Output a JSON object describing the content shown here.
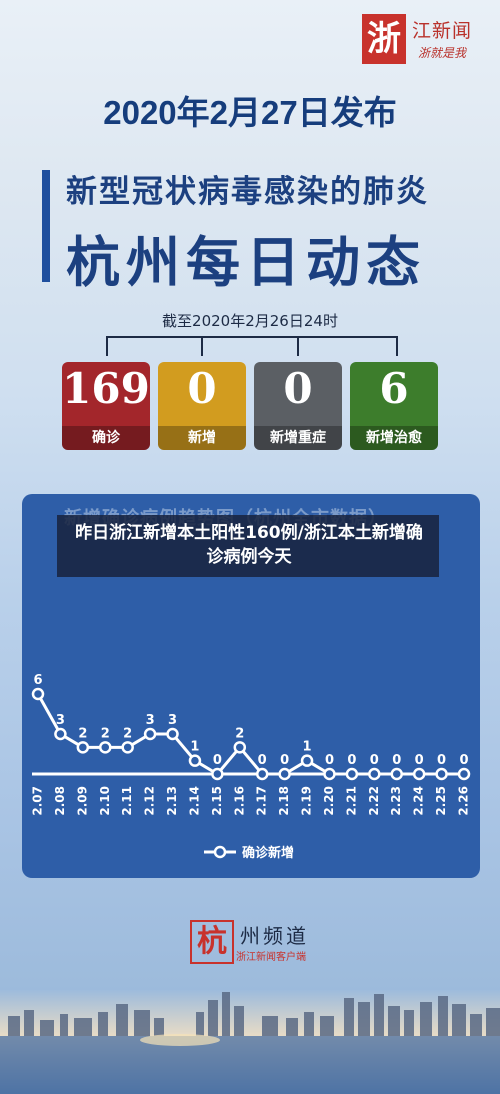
{
  "header": {
    "logo_seal": "浙",
    "logo_name": "江新闻",
    "logo_motto": "浙就是我"
  },
  "release_date": "2020年2月27日发布",
  "title": {
    "line1": "新型冠状病毒感染的肺炎",
    "line2": "杭州每日动态"
  },
  "as_of": "截至2020年2月26日24时",
  "stats": [
    {
      "value": "169",
      "label": "确诊",
      "color": "#a3262b"
    },
    {
      "value": "0",
      "label": "新增",
      "color": "#d29c1f"
    },
    {
      "value": "0",
      "label": "新增重症",
      "color": "#5b5f64"
    },
    {
      "value": "6",
      "label": "新增治愈",
      "color": "#3d7d2c"
    }
  ],
  "chart_title": "新增确诊病例趋势图（杭州全市数据）",
  "overlay_text": "昨日浙江新增本土阳性160例/浙江本土新增确诊病例今天",
  "chart_data": {
    "type": "line",
    "x": [
      "2.07",
      "2.08",
      "2.09",
      "2.10",
      "2.11",
      "2.12",
      "2.13",
      "2.14",
      "2.15",
      "2.16",
      "2.17",
      "2.18",
      "2.19",
      "2.20",
      "2.21",
      "2.22",
      "2.23",
      "2.24",
      "2.25",
      "2.26"
    ],
    "series": [
      {
        "name": "确诊新增",
        "values": [
          6,
          3,
          2,
          2,
          2,
          3,
          3,
          1,
          0,
          2,
          0,
          0,
          1,
          0,
          0,
          0,
          0,
          0,
          0,
          0
        ]
      }
    ],
    "legend": "bottom"
  },
  "colors": {
    "chart_bg": "#2e5ea8",
    "line": "#ffffff",
    "title_blue": "#1c4080"
  },
  "footer": {
    "logo_seal": "杭",
    "logo_name": "州频道",
    "logo_sub": "浙江新闻客户端"
  }
}
